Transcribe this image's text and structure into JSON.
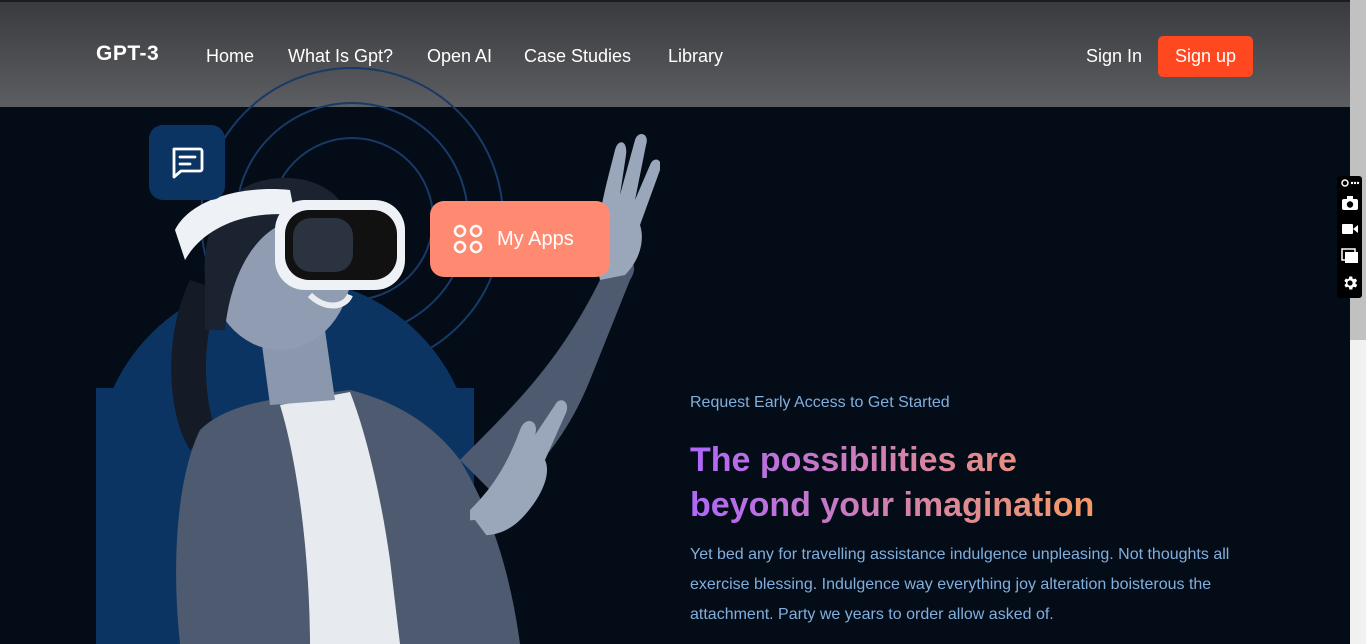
{
  "nav": {
    "logo": "GPT-3",
    "links": [
      "Home",
      "What Is Gpt?",
      "Open AI",
      "Case Studies",
      "Library"
    ],
    "signin": "Sign In",
    "signup": "Sign up"
  },
  "hero": {
    "apps_label": "My Apps",
    "subtitle": "Request Early Access to Get Started",
    "headline_line1": "The possibilities are",
    "headline_line2": "beyond your imagination",
    "body": "Yet bed any for travelling assistance indulgence unpleasing. Not thoughts all exercise blessing. Indulgence way everything joy alteration boisterous the attachment. Party we years to order allow asked of."
  },
  "colors": {
    "background": "#040C18",
    "signup_button": "#FF4820",
    "apps_badge": "#FF8A71",
    "accent_blue": "#0b3463",
    "text_muted": "#81AFDD",
    "gradient_start": "#AE67FA",
    "gradient_end": "#F49867"
  },
  "icons": [
    "chat-icon",
    "apps-grid-icon",
    "link-icon",
    "more-icon",
    "camera-icon",
    "video-icon",
    "window-icon",
    "gear-icon"
  ]
}
